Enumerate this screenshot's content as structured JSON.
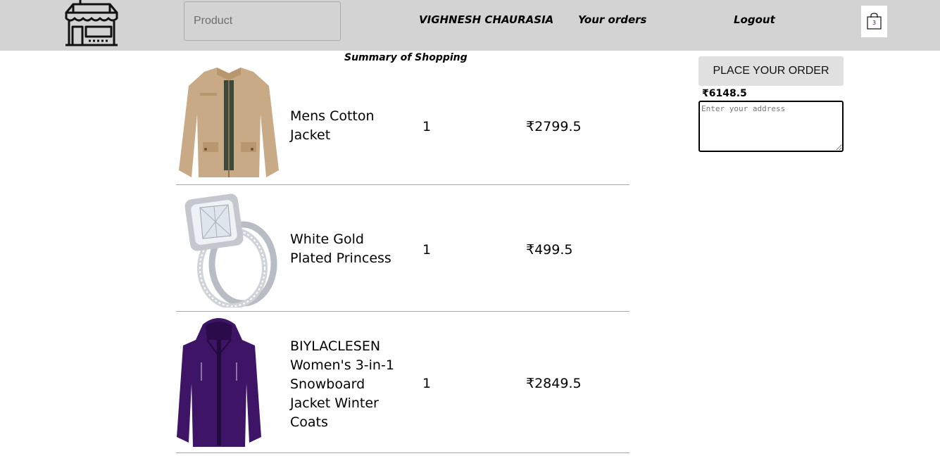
{
  "header": {
    "search": {
      "placeholder": "Product",
      "value": ""
    },
    "nav": {
      "user": "VIGHNESH CHAURASIA",
      "orders": "Your orders",
      "logout": "Logout"
    },
    "cart": {
      "count": "3"
    },
    "logo_icon": "store-icon",
    "cart_icon": "shopping-bag-icon"
  },
  "main": {
    "title": "Summary of Shopping",
    "items": [
      {
        "name": "Mens Cotton Jacket",
        "qty": "1",
        "price": "₹2799.5",
        "image_icon": "beige-jacket-image"
      },
      {
        "name": "White Gold Plated Princess",
        "qty": "1",
        "price": "₹499.5",
        "image_icon": "ring-image"
      },
      {
        "name": "BIYLACLESEN Women's 3-in-1 Snowboard Jacket Winter Coats",
        "qty": "1",
        "price": "₹2849.5",
        "image_icon": "purple-jacket-image"
      }
    ]
  },
  "sidebar": {
    "place_order_label": "PLACE YOUR ORDER",
    "total": "₹6148.5",
    "address": {
      "placeholder": "Enter your address",
      "value": ""
    }
  },
  "colors": {
    "header_bg": "#d3d3d3",
    "button_bg": "#e0e0e0",
    "divider": "#aaaaaa",
    "cart_count": "#4b0082"
  }
}
